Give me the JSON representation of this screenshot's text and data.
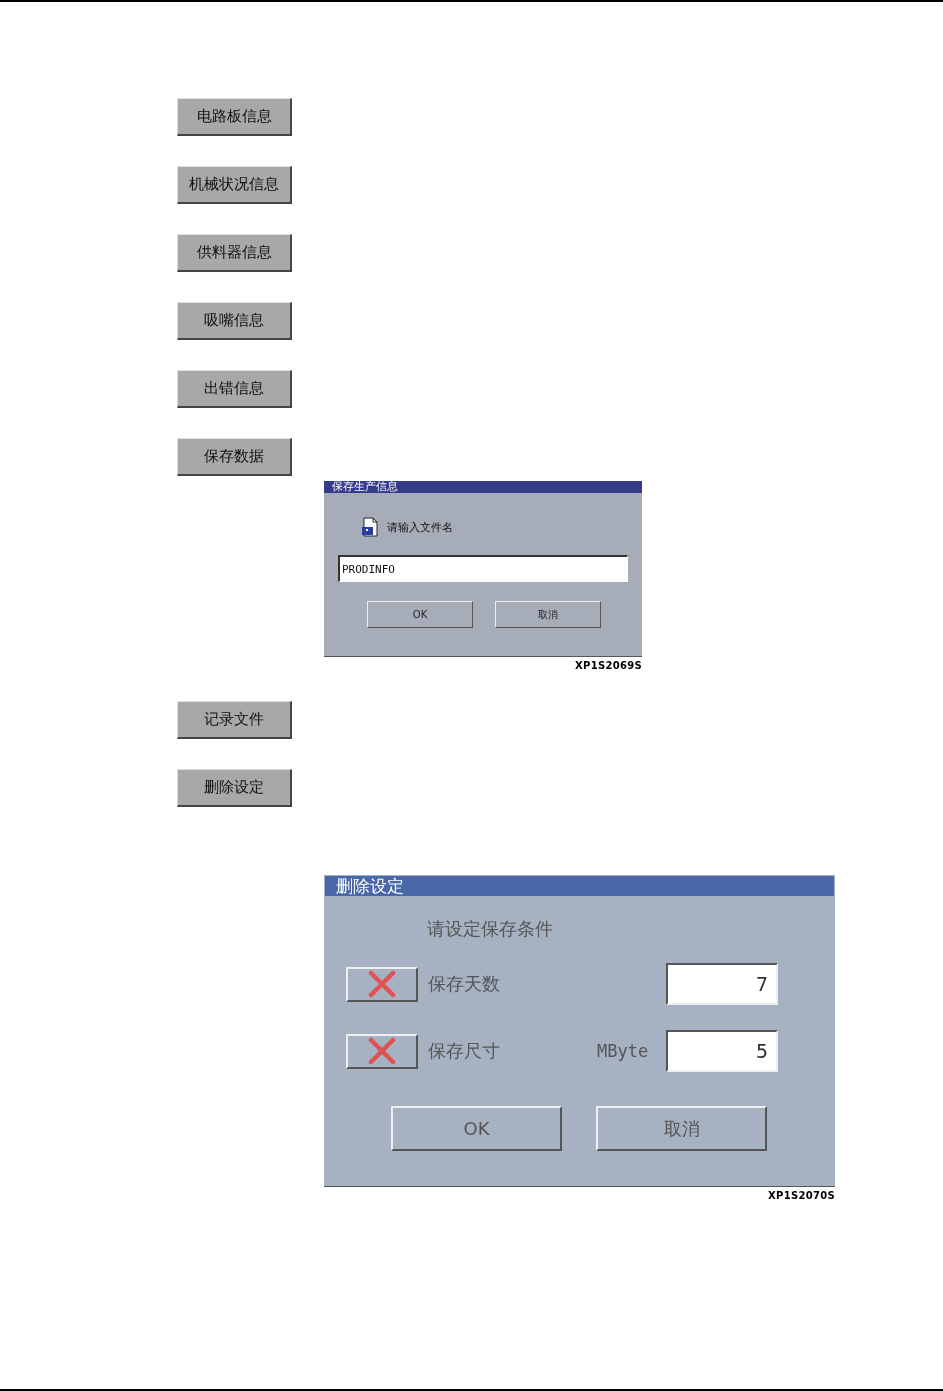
{
  "items": [
    {
      "kind": "button",
      "label": "电路板信息"
    },
    {
      "kind": "button",
      "label": "机械状况信息"
    },
    {
      "kind": "button",
      "label": "供料器信息"
    },
    {
      "kind": "button",
      "label": "吸嘴信息"
    },
    {
      "kind": "button",
      "label": "出错信息"
    },
    {
      "kind": "button",
      "label": "保存数据"
    },
    {
      "kind": "save_dialog",
      "title": "保存生产信息",
      "prompt": "请输入文件名",
      "value": "PRODINFO",
      "buttons": [
        "OK",
        "取消"
      ],
      "caption": "XP1S2069S"
    },
    {
      "kind": "button",
      "label": "记录文件"
    },
    {
      "kind": "button",
      "label": "删除设定"
    },
    {
      "kind": "delete_dialog",
      "title": "删除设定",
      "prompt": "请设定保存条件",
      "rows": [
        {
          "checked": false,
          "label": "保存天数",
          "value": "7"
        },
        {
          "checked": false,
          "label": "保存尺寸",
          "unit": "MByte",
          "value": "5"
        }
      ],
      "buttons": [
        "OK",
        "取消"
      ],
      "caption": "XP1S2070S"
    }
  ]
}
